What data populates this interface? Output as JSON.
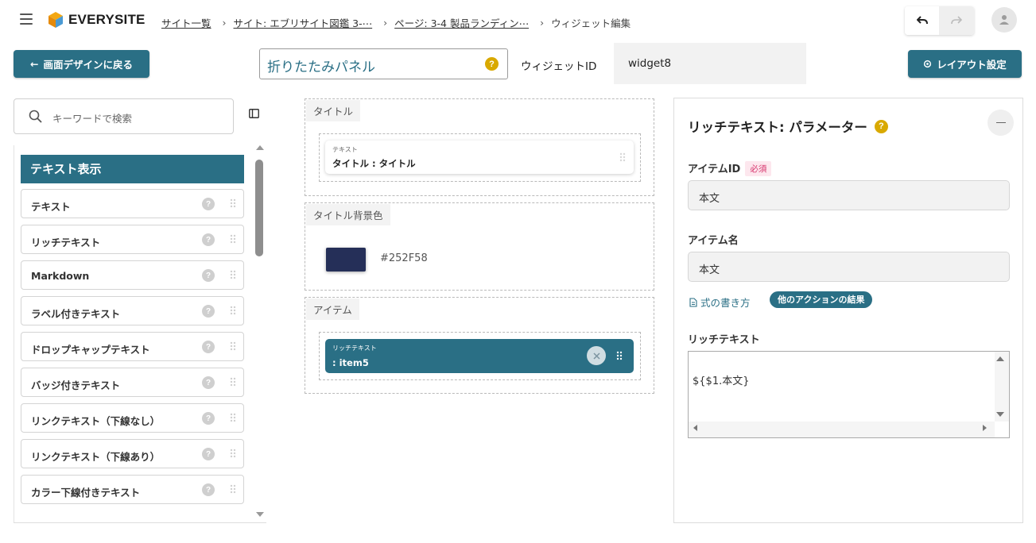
{
  "header": {
    "logo_text": "EVERYSITE",
    "breadcrumbs": [
      {
        "label": "サイト一覧"
      },
      {
        "label": "サイト: エブリサイト図鑑 3-⋯"
      },
      {
        "label": "ページ: 3-4 製品ランディン⋯"
      },
      {
        "label": "ウィジェット編集"
      }
    ]
  },
  "toolbar": {
    "back_label": "画面デザインに戻る",
    "widget_name": "折りたたみパネル",
    "widget_id_label": "ウィジェットID",
    "widget_id_value": "widget8",
    "layout_label": "レイアウト設定"
  },
  "left_panel": {
    "search_placeholder": "キーワードで検索",
    "category": "テキスト表示",
    "items": [
      {
        "label": "テキスト"
      },
      {
        "label": "リッチテキスト"
      },
      {
        "label": "Markdown"
      },
      {
        "label": "ラベル付きテキスト"
      },
      {
        "label": "ドロップキャップテキスト"
      },
      {
        "label": "バッジ付きテキスト"
      },
      {
        "label": "リンクテキスト（下線なし）"
      },
      {
        "label": "リンクテキスト（下線あり）"
      },
      {
        "label": "カラー下線付きテキスト"
      }
    ],
    "help_glyph": "?"
  },
  "canvas": {
    "title_section": {
      "label": "タイトル",
      "card_type": "テキスト",
      "card_value": "タイトル : タイトル"
    },
    "bg_section": {
      "label": "タイトル背景色",
      "color_hex": "#252F58"
    },
    "item_section": {
      "label": "アイテム",
      "card_type": "リッチテキスト",
      "card_value": ": item5"
    }
  },
  "right_panel": {
    "title": "リッチテキスト: パラメーター",
    "help_glyph": "?",
    "item_id_label": "アイテムID",
    "required_label": "必須",
    "item_id_value": "本文",
    "item_name_label": "アイテム名",
    "item_name_value": "本文",
    "formula_link": "式の書き方",
    "action_chip": "他のアクションの結果",
    "rich_text_label": "リッチテキスト",
    "rich_text_value": "${$1.本文}"
  },
  "colors": {
    "accent": "#2a6f85",
    "help_yellow": "#d9a900",
    "swatch": "#252F58",
    "required": "#d6336c"
  },
  "icons": {
    "menu": "hamburger-icon",
    "undo": "undo-icon",
    "redo": "redo-icon",
    "user": "user-icon",
    "back": "arrow-left-icon",
    "settings": "gear-icon",
    "search": "search-icon",
    "panel": "panel-toggle-icon",
    "grip": "drag-handle-icon",
    "remove": "close-icon",
    "doc": "document-icon"
  }
}
